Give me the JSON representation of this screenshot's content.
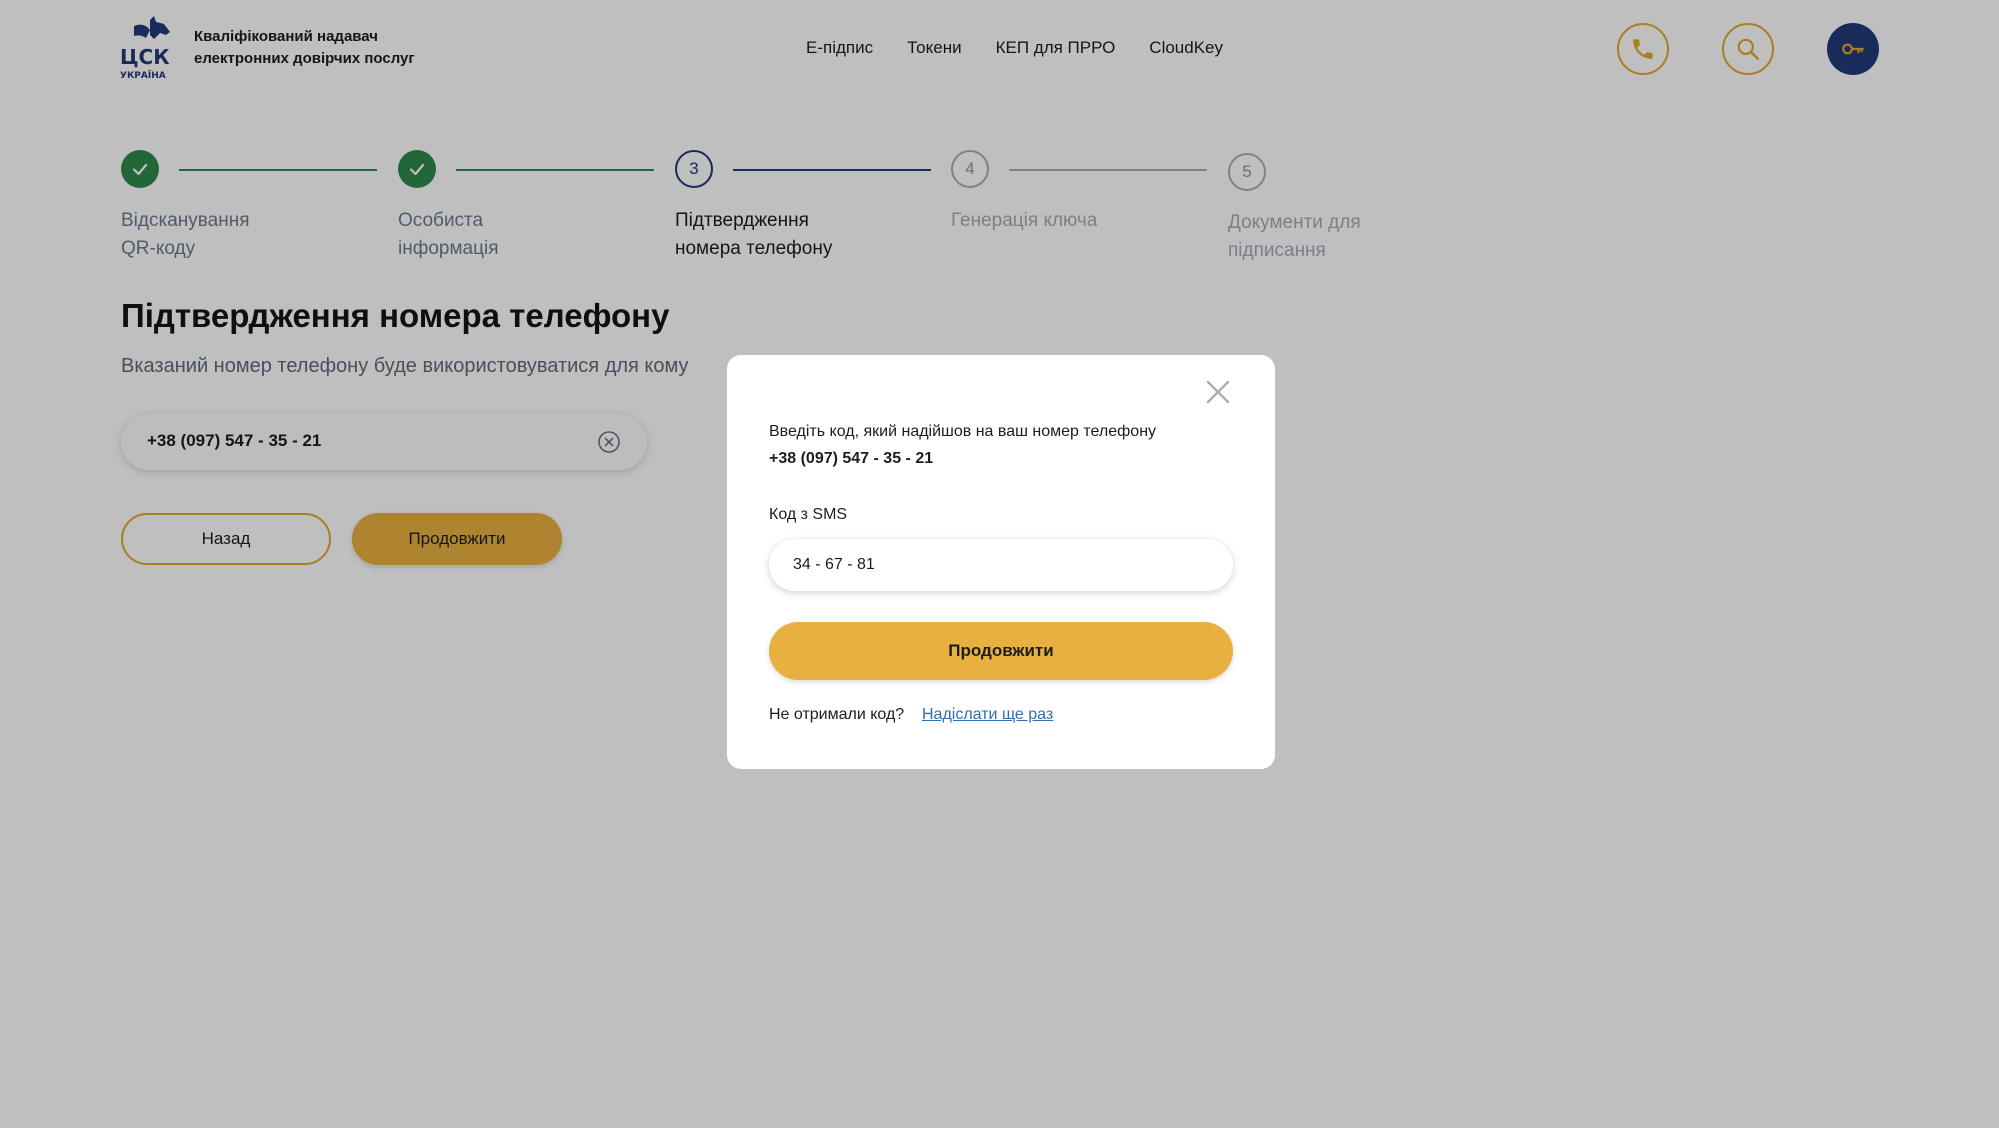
{
  "header": {
    "logo_text": "ЦСК УКРАЇНА",
    "company_line1": "Кваліфікований надавач",
    "company_line2": "електронних довірчих послуг",
    "nav": [
      "Е-підпис",
      "Токени",
      "КЕП для ПРРО",
      "CloudKey"
    ],
    "icons": [
      "phone-icon",
      "search-icon",
      "key-icon"
    ]
  },
  "stepper": {
    "steps": [
      {
        "number": "1",
        "line1": "Відсканування",
        "line2": "QR-коду",
        "state": "done"
      },
      {
        "number": "2",
        "line1": "Особиста",
        "line2": "інформація",
        "state": "done"
      },
      {
        "number": "3",
        "line1": "Підтвердження",
        "line2": "номера телефону",
        "state": "active"
      },
      {
        "number": "4",
        "line1": "Генерація ключа",
        "line2": "",
        "state": "future"
      },
      {
        "number": "5",
        "line1": "Документи для",
        "line2": "підписання",
        "state": "future"
      }
    ]
  },
  "main": {
    "title": "Підтвердження номера телефону",
    "subtitle": "Вказаний номер телефону буде використовуватися для кому",
    "phone_value": "+38 (097) 547 - 35 - 21",
    "back_label": "Назад",
    "continue_label": "Продовжити"
  },
  "modal": {
    "instruction": "Введіть код, який надійшов на ваш номер телефону",
    "phone": "+38 (097) 547 - 35 - 21",
    "code_label": "Код з SMS",
    "code_value": "34 - 67 - 81",
    "submit_label": "Продовжити",
    "resend_text": "Не отримали код?",
    "resend_link": "Надіслати ще раз"
  },
  "colors": {
    "accent_gold": "#e8b040",
    "brand_blue": "#213a7a",
    "done_green": "#2d8a4e",
    "link_blue": "#2f6fb0"
  }
}
